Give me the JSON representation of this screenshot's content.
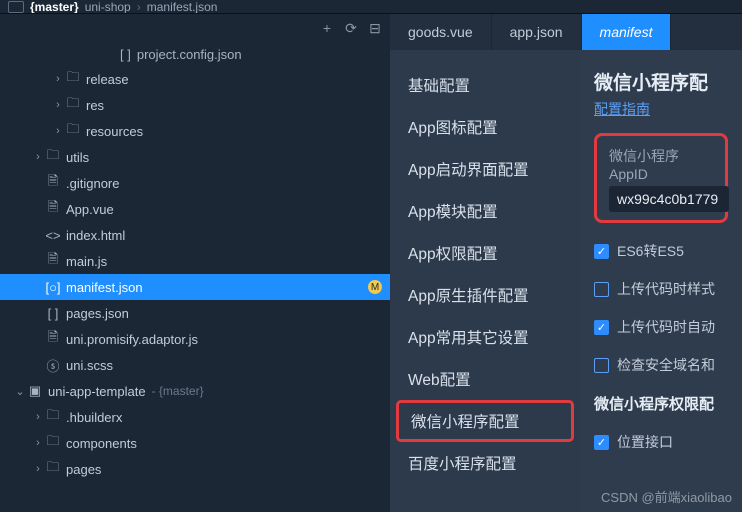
{
  "titlebar": {
    "branch": "{master}",
    "project": "uni-shop",
    "file": "manifest.json"
  },
  "breadcrumb": {
    "icon_label": "[ ]",
    "file": "project.config.json"
  },
  "explorer_header_icons": {
    "add": "+",
    "refresh": "⟳",
    "collapse": "⊟"
  },
  "tree": {
    "release": "release",
    "res": "res",
    "resources": "resources",
    "utils": "utils",
    "gitignore": ".gitignore",
    "appvue": "App.vue",
    "indexhtml": "index.html",
    "mainjs": "main.js",
    "manifest": "manifest.json",
    "manifest_badge": "M",
    "pagesjson": "pages.json",
    "promisify": "uni.promisify.adaptor.js",
    "uniscss": "uni.scss",
    "template": "uni-app-template",
    "template_suffix": " - {master}",
    "hbuilderx": ".hbuilderx",
    "components": "components",
    "pages": "pages"
  },
  "tabs": {
    "goods": "goods.vue",
    "appjson": "app.json",
    "manifest": "manifest"
  },
  "config_nav": {
    "basic": "基础配置",
    "icon": "App图标配置",
    "splash": "App启动界面配置",
    "module": "App模块配置",
    "perm": "App权限配置",
    "native": "App原生插件配置",
    "other": "App常用其它设置",
    "web": "Web配置",
    "wx": "微信小程序配置",
    "baidu": "百度小程序配置"
  },
  "config_panel": {
    "title": "微信小程序配",
    "link": "配置指南",
    "appid_label": "微信小程序AppID",
    "appid_value": "wx99c4c0b1779",
    "es6": "ES6转ES5",
    "upload_style": "上传代码时样式",
    "auto_upload": "上传代码时自动",
    "check_domain": "检查安全域名和",
    "perm_title": "微信小程序权限配",
    "location": "位置接口"
  },
  "watermark": "CSDN @前端xiaolibao"
}
